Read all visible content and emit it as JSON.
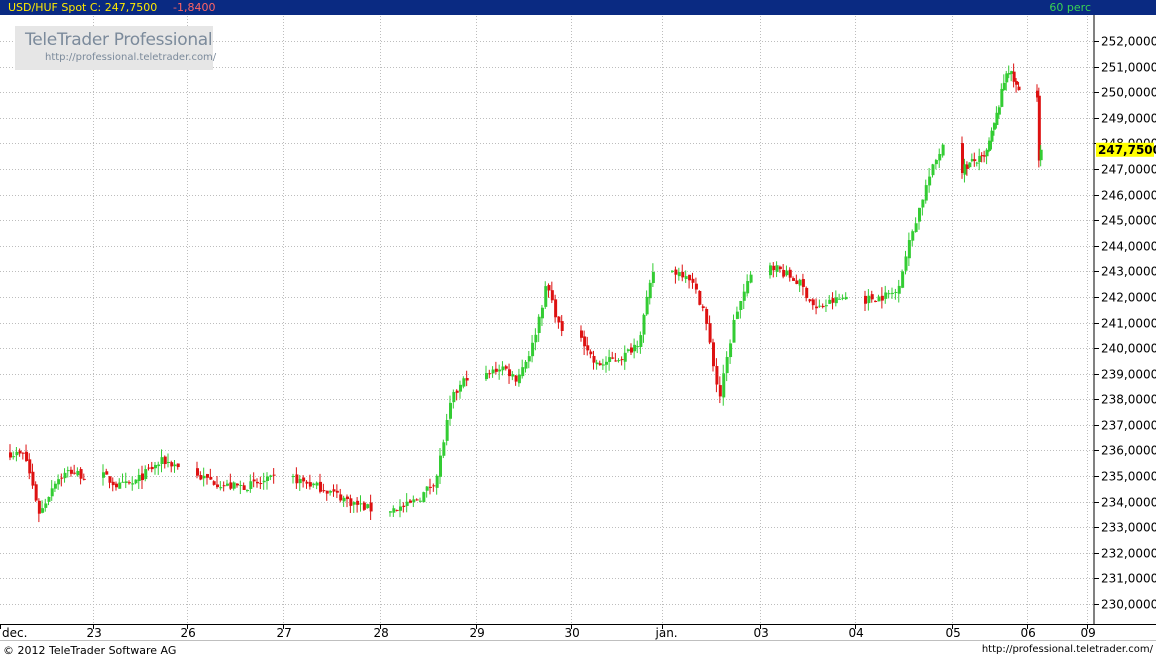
{
  "header": {
    "symbol_label": "USD/HUF Spot  C: 247,7500",
    "change": "-1,8400",
    "interval": "60 perc"
  },
  "logo": {
    "line1": "TeleTrader Professional",
    "line2": "http://professional.teletrader.com/"
  },
  "footer": {
    "copyright": "© 2012 TeleTrader Software AG",
    "url": "http://professional.teletrader.com/"
  },
  "colors": {
    "header_bg": "#0a2a82",
    "up_candle": "#33cc33",
    "down_candle": "#dd1111",
    "last_price_bg": "#ffff00",
    "grid": "#bdbdbd"
  },
  "chart_data": {
    "type": "candlestick",
    "title": "USD/HUF Spot",
    "ylim": [
      229.5,
      252.5
    ],
    "y_ticks": [
      "230,0000",
      "231,0000",
      "232,0000",
      "233,0000",
      "234,0000",
      "235,0000",
      "236,0000",
      "237,0000",
      "238,0000",
      "239,0000",
      "240,0000",
      "241,0000",
      "242,0000",
      "243,0000",
      "244,0000",
      "245,0000",
      "246,0000",
      "247,0000",
      "248,0000",
      "249,0000",
      "250,0000",
      "251,0000",
      "252,0000"
    ],
    "y_tick_values": [
      230,
      231,
      232,
      233,
      234,
      235,
      236,
      237,
      238,
      239,
      240,
      241,
      242,
      243,
      244,
      245,
      246,
      247,
      248,
      249,
      250,
      251,
      252
    ],
    "x_ticks": [
      "dec.",
      "23",
      "26",
      "27",
      "28",
      "29",
      "30",
      "jan.",
      "03",
      "04",
      "05",
      "06",
      "09"
    ],
    "last_price": 247.75,
    "last_price_label": "247,7500",
    "candles_per_day": 24,
    "days": [
      {
        "label": "dec.",
        "anchors": [
          235.9,
          235.8,
          233.5,
          234.8,
          235.2,
          235.0
        ]
      },
      {
        "label": "23",
        "anchors": [
          235.0,
          234.6,
          234.7,
          235.2,
          235.6,
          235.4
        ]
      },
      {
        "label": "26",
        "anchors": [
          235.0,
          234.8,
          234.6,
          234.6,
          234.7,
          234.9
        ]
      },
      {
        "label": "27",
        "anchors": [
          234.9,
          234.7,
          234.5,
          234.2,
          233.9,
          233.7
        ]
      },
      {
        "label": "28",
        "anchors": [
          233.7,
          233.8,
          234.2,
          234.9,
          238.0,
          238.9
        ]
      },
      {
        "label": "29",
        "anchors": [
          238.9,
          239.3,
          238.8,
          240.0,
          242.5,
          240.5
        ]
      },
      {
        "label": "30",
        "anchors": [
          240.5,
          239.3,
          239.5,
          239.7,
          240.3,
          243.0
        ]
      },
      {
        "label": "jan.",
        "anchors": [
          243.0,
          242.9,
          241.5,
          238.0,
          241.3,
          242.8
        ]
      },
      {
        "label": "03",
        "anchors": [
          243.3,
          242.9,
          242.5,
          241.5,
          241.8,
          242.0
        ]
      },
      {
        "label": "04",
        "anchors": [
          241.9,
          242.0,
          242.2,
          244.5,
          246.5,
          248.0
        ]
      },
      {
        "label": "05",
        "anchors": [
          247.0,
          247.3,
          247.4,
          249.0,
          251.0,
          250.0
        ]
      },
      {
        "label": "06",
        "anchors": [
          249.8,
          247.5,
          247.75
        ]
      }
    ]
  }
}
